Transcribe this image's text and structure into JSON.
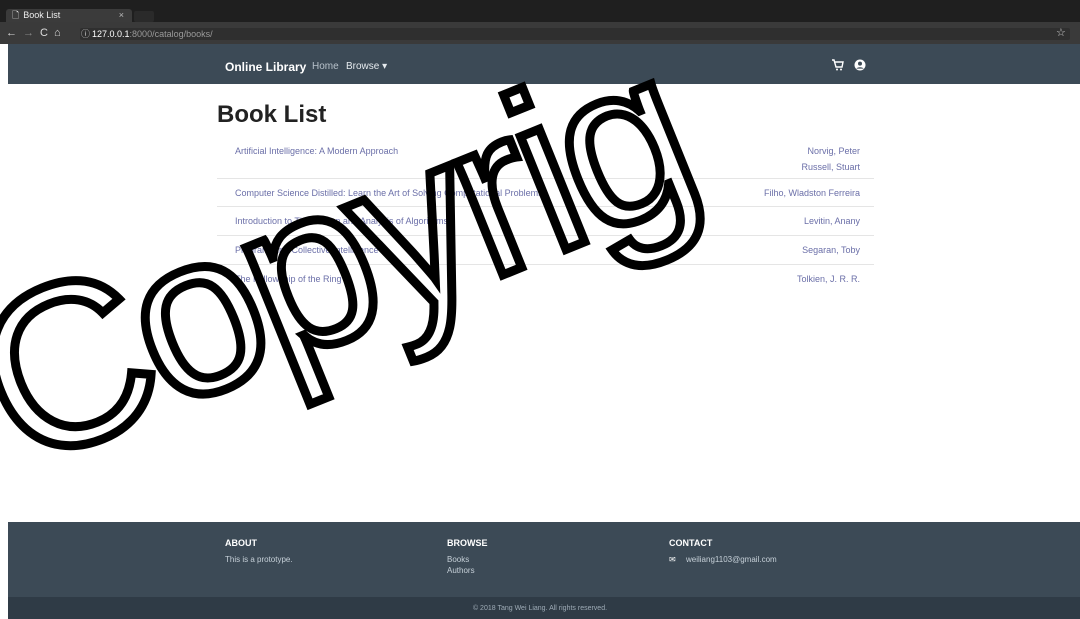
{
  "browser": {
    "tab_title": "Book List",
    "tab_close": "×",
    "url_host": "127.0.0.1",
    "url_path": ":8000/catalog/books/",
    "nav_back": "←",
    "nav_forward": "→",
    "nav_reload": "C",
    "nav_home": "⌂",
    "info": "ⓘ",
    "star": "☆"
  },
  "navbar": {
    "brand": "Online Library",
    "home": "Home",
    "browse": "Browse ▾",
    "cart_icon": "shopping-cart-icon",
    "account_icon": "user-icon"
  },
  "page": {
    "title": "Book List"
  },
  "books": [
    {
      "title": "Artificial Intelligence: A Modern Approach",
      "authors": [
        "Norvig, Peter",
        "Russell, Stuart"
      ]
    },
    {
      "title": "Computer Science Distilled: Learn the Art of Solving Computational Problems",
      "authors": [
        "Filho, Wladston Ferreira"
      ]
    },
    {
      "title": "Introduction to The Design and Analysis of Algorithms",
      "authors": [
        "Levitin, Anany"
      ]
    },
    {
      "title": "Programming Collective Intelligence",
      "authors": [
        "Segaran, Toby"
      ]
    },
    {
      "title": "The Fellowship of the Ring",
      "authors": [
        "Tolkien, J. R. R."
      ]
    }
  ],
  "footer": {
    "about_heading": "ABOUT",
    "about_text": "This is a prototype.",
    "browse_heading": "BROWSE",
    "browse_books": "Books",
    "browse_authors": "Authors",
    "contact_heading": "CONTACT",
    "contact_email": "weiliang1103@gmail.com",
    "copyright": "© 2018 Tang Wei Liang. All rights reserved."
  },
  "colors": {
    "navbar_bg": "#3c4a56",
    "link_color": "#6b6fa8",
    "watermark": "#000000"
  },
  "watermark": {
    "text": "Copyright"
  }
}
